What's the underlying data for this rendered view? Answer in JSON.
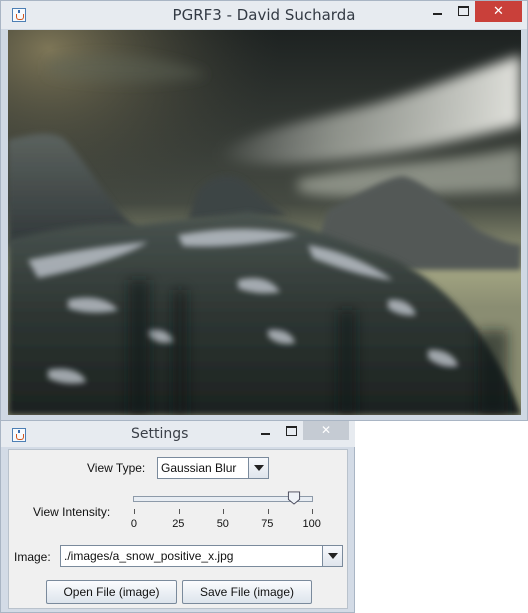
{
  "main_window": {
    "title": "PGRF3 - David Sucharda",
    "close_glyph": "✕"
  },
  "settings_window": {
    "title": "Settings",
    "close_glyph": "✕",
    "view_type": {
      "label": "View Type:",
      "selected": "Gaussian Blur"
    },
    "view_intensity": {
      "label": "View Intensity:",
      "value": 90,
      "min": 0,
      "max": 100,
      "tick_labels": [
        "0",
        "25",
        "50",
        "75",
        "100"
      ]
    },
    "image": {
      "label": "Image:",
      "selected": "./images/a_snow_positive_x.jpg"
    },
    "buttons": {
      "open_label": "Open File (image)",
      "save_label": "Save File (image)"
    }
  },
  "colors": {
    "title_bar": "#e7ebf0",
    "window_frame": "#cfd8e3",
    "close_active": "#c9403a",
    "close_inactive": "#c5cbd3"
  }
}
